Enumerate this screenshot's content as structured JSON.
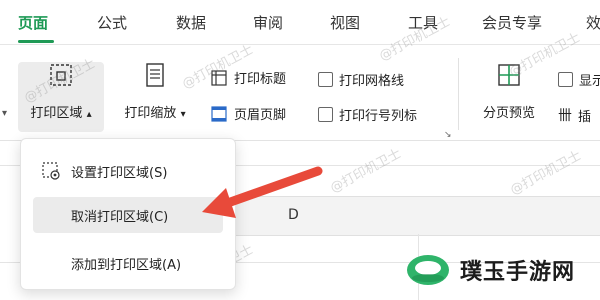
{
  "tabs": [
    {
      "label": "页面",
      "active": true
    },
    {
      "label": "公式"
    },
    {
      "label": "数据"
    },
    {
      "label": "审阅"
    },
    {
      "label": "视图"
    },
    {
      "label": "工具"
    },
    {
      "label": "会员专享"
    },
    {
      "label": "效"
    }
  ],
  "ribbon": {
    "print_area_label": "打印区域",
    "print_scale_label": "打印缩放",
    "print_titles_label": "打印标题",
    "header_footer_label": "页眉页脚",
    "print_gridlines_label": "打印网格线",
    "print_row_col_label": "打印行号列标",
    "page_break_preview_label": "分页预览",
    "show_label": "显示",
    "insert_label": "插"
  },
  "dropdown": {
    "items": [
      {
        "label": "设置打印区域(S)"
      },
      {
        "label": "取消打印区域(C)"
      },
      {
        "label": "添加到打印区域(A)"
      }
    ]
  },
  "sheet": {
    "column_d": "D"
  },
  "watermark": "@打印机卫士",
  "brand": {
    "name": "璞玉手游网"
  },
  "colors": {
    "accent": "#1f9a56",
    "arrow": "#e84a3a"
  }
}
